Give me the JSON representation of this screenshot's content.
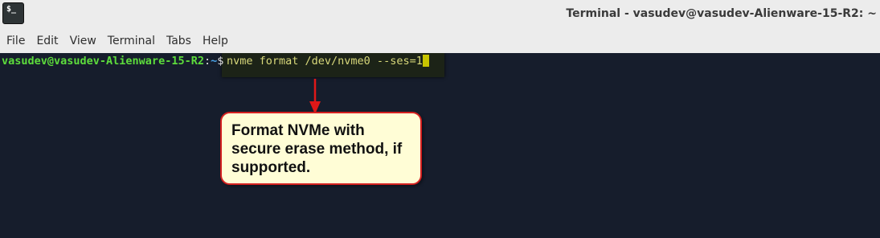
{
  "window": {
    "icon_glyph": "$_",
    "title": "Terminal - vasudev@vasudev-Alienware-15-R2: ~"
  },
  "menu": {
    "items": [
      "File",
      "Edit",
      "View",
      "Terminal",
      "Tabs",
      "Help"
    ]
  },
  "terminal": {
    "prompt_user_host": "vasudev@vasudev-Alienware-15-R2",
    "prompt_separator": ":",
    "prompt_path": "~",
    "prompt_symbol": "$",
    "command": "nvme format /dev/nvme0 --ses=1"
  },
  "annotation": {
    "callout_lines": [
      "Format NVMe with",
      "secure erase method, if",
      "supported."
    ],
    "arrow_icon": "arrow-down-icon"
  },
  "colors": {
    "terminal_bg": "#161d2c",
    "prompt_user": "#5ddc3c",
    "prompt_path": "#4aa3e8",
    "command_text": "#d8d87a",
    "callout_border": "#d42020",
    "callout_bg": "#fffdd6"
  }
}
